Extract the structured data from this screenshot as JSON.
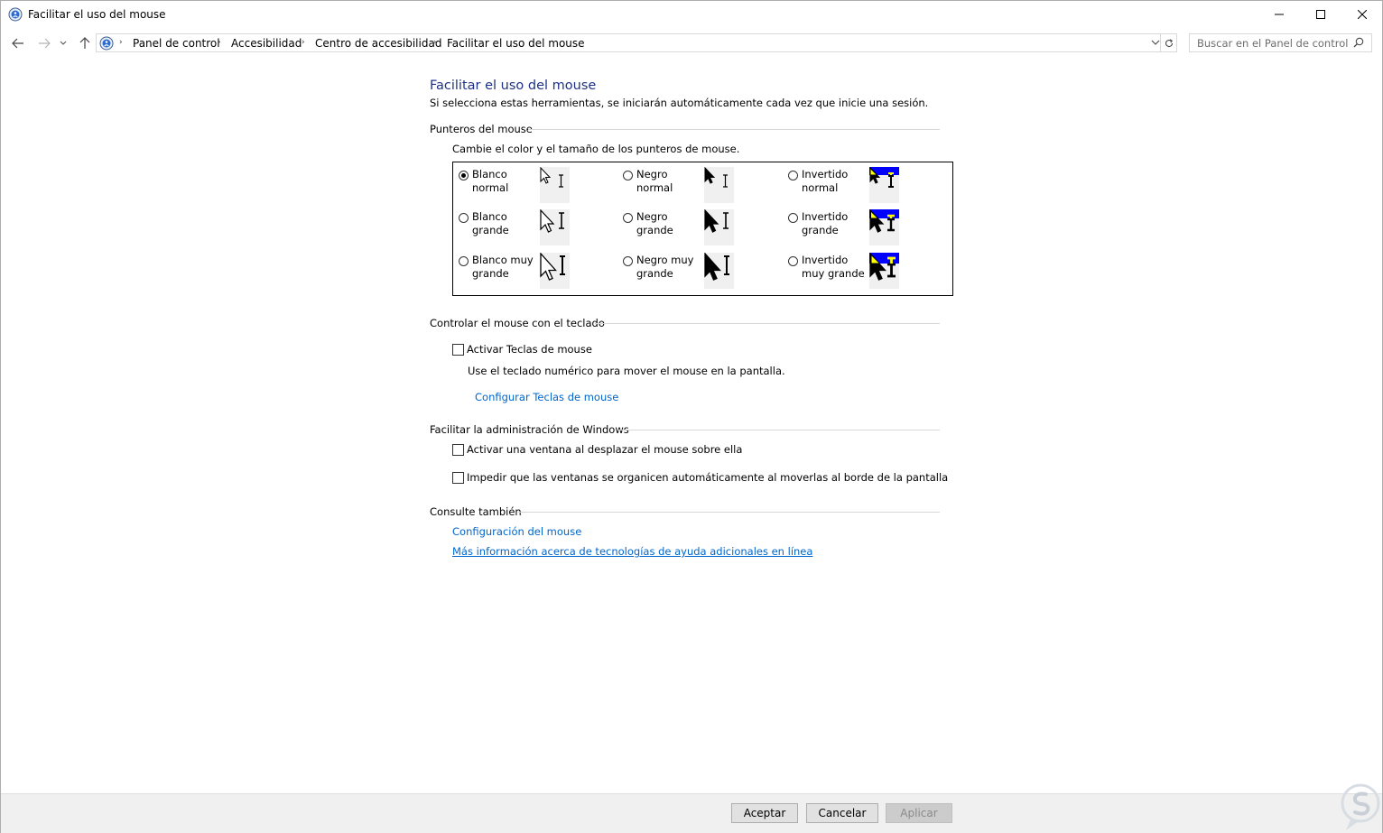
{
  "window": {
    "title": "Facilitar el uso del mouse",
    "controls": [
      "minimize",
      "maximize",
      "close"
    ]
  },
  "address_bar": {
    "breadcrumbs": [
      "Panel de control",
      "Accesibilidad",
      "Centro de accesibilidad",
      "Facilitar el uso del mouse"
    ],
    "separator": "›"
  },
  "search": {
    "placeholder": "Buscar en el Panel de control"
  },
  "page": {
    "title": "Facilitar el uso del mouse",
    "subtitle": "Si selecciona estas herramientas, se iniciarán automáticamente cada vez que inicie una sesión."
  },
  "pointers": {
    "heading": "Punteros del mouse",
    "description": "Cambie el color y el tamaño de los punteros de mouse.",
    "schemes": [
      {
        "label": "Blanco\nnormal",
        "selected": true,
        "style": "white",
        "size": "normal"
      },
      {
        "label": "Negro\nnormal",
        "selected": false,
        "style": "black",
        "size": "normal"
      },
      {
        "label": "Invertido\nnormal",
        "selected": false,
        "style": "inverted",
        "size": "normal"
      },
      {
        "label": "Blanco\ngrande",
        "selected": false,
        "style": "white",
        "size": "large"
      },
      {
        "label": "Negro\ngrande",
        "selected": false,
        "style": "black",
        "size": "large"
      },
      {
        "label": "Invertido\ngrande",
        "selected": false,
        "style": "inverted",
        "size": "large"
      },
      {
        "label": "Blanco muy\ngrande",
        "selected": false,
        "style": "white",
        "size": "xlarge"
      },
      {
        "label": "Negro muy\ngrande",
        "selected": false,
        "style": "black",
        "size": "xlarge"
      },
      {
        "label": "Invertido\nmuy grande",
        "selected": false,
        "style": "inverted",
        "size": "xlarge"
      }
    ]
  },
  "keyboard": {
    "heading": "Controlar el mouse con el teclado",
    "checkbox_label": "Activar Teclas de mouse",
    "checked": false,
    "description": "Use el teclado numérico para mover el mouse en la pantalla.",
    "link": "Configurar Teclas de mouse"
  },
  "windows_mgmt": {
    "heading": "Facilitar la administración de Windows",
    "options": [
      {
        "label": "Activar una ventana al desplazar el mouse sobre ella",
        "checked": false
      },
      {
        "label": "Impedir que las ventanas se organicen automáticamente al moverlas al borde de la pantalla",
        "checked": false
      }
    ]
  },
  "see_also": {
    "heading": "Consulte también",
    "links": [
      "Configuración del mouse",
      "Más información acerca de tecnologías de ayuda adicionales en línea"
    ]
  },
  "buttons": {
    "ok": "Aceptar",
    "cancel": "Cancelar",
    "apply": "Aplicar",
    "apply_disabled": true
  },
  "colors": {
    "title_blue": "#1e3287",
    "link_blue": "#0066cc",
    "inverted_preview_blue": "#0000ff",
    "inverted_preview_yellow": "#ffff00"
  }
}
